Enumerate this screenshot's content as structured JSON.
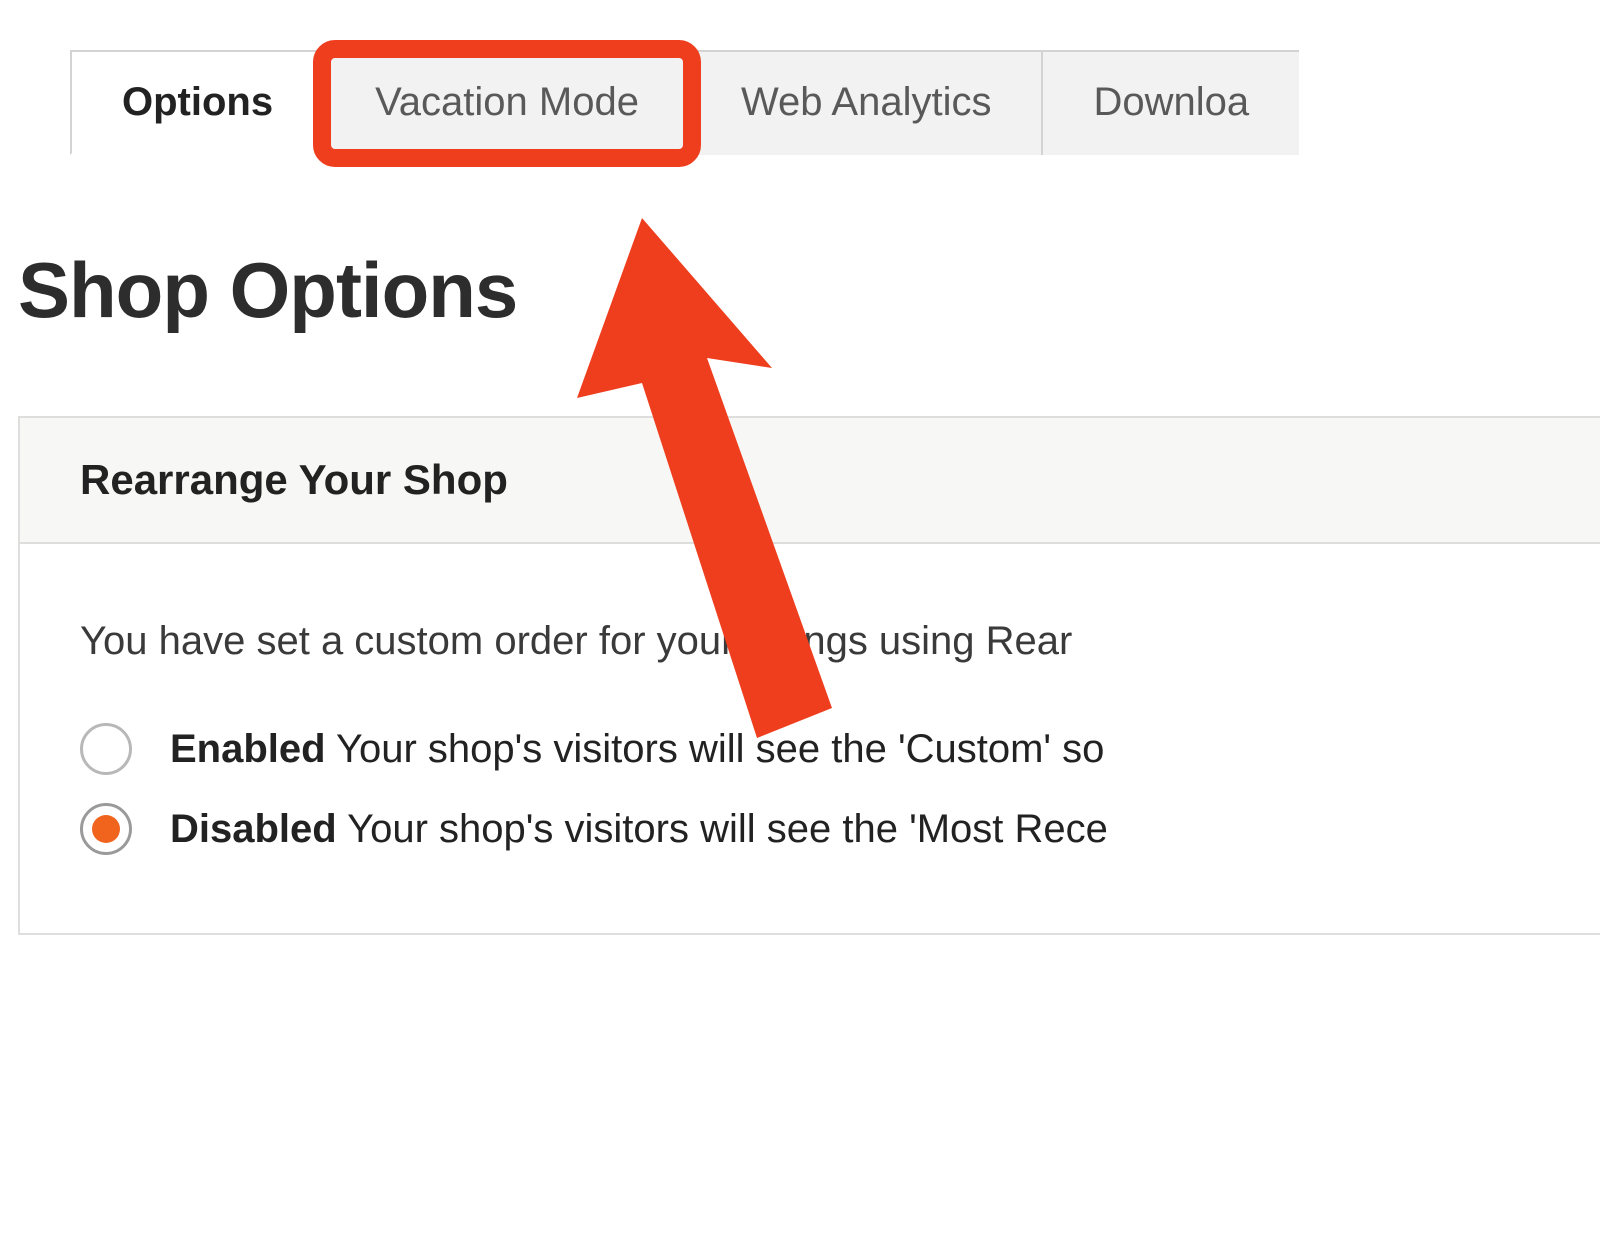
{
  "tabs": [
    {
      "label": "Options",
      "active": true,
      "highlighted": false
    },
    {
      "label": "Vacation Mode",
      "active": false,
      "highlighted": true
    },
    {
      "label": "Web Analytics",
      "active": false,
      "highlighted": false
    },
    {
      "label": "Downloa",
      "active": false,
      "highlighted": false
    }
  ],
  "page_title": "Shop Options",
  "section": {
    "title": "Rearrange Your Shop",
    "description": "You have set a custom order for your listings using Rear",
    "options": [
      {
        "strong": "Enabled",
        "rest": " Your shop's visitors will see the 'Custom' so",
        "selected": false
      },
      {
        "strong": "Disabled",
        "rest": " Your shop's visitors will see the 'Most Rece",
        "selected": true
      }
    ]
  },
  "annotation": {
    "color": "#ef3e1e"
  }
}
